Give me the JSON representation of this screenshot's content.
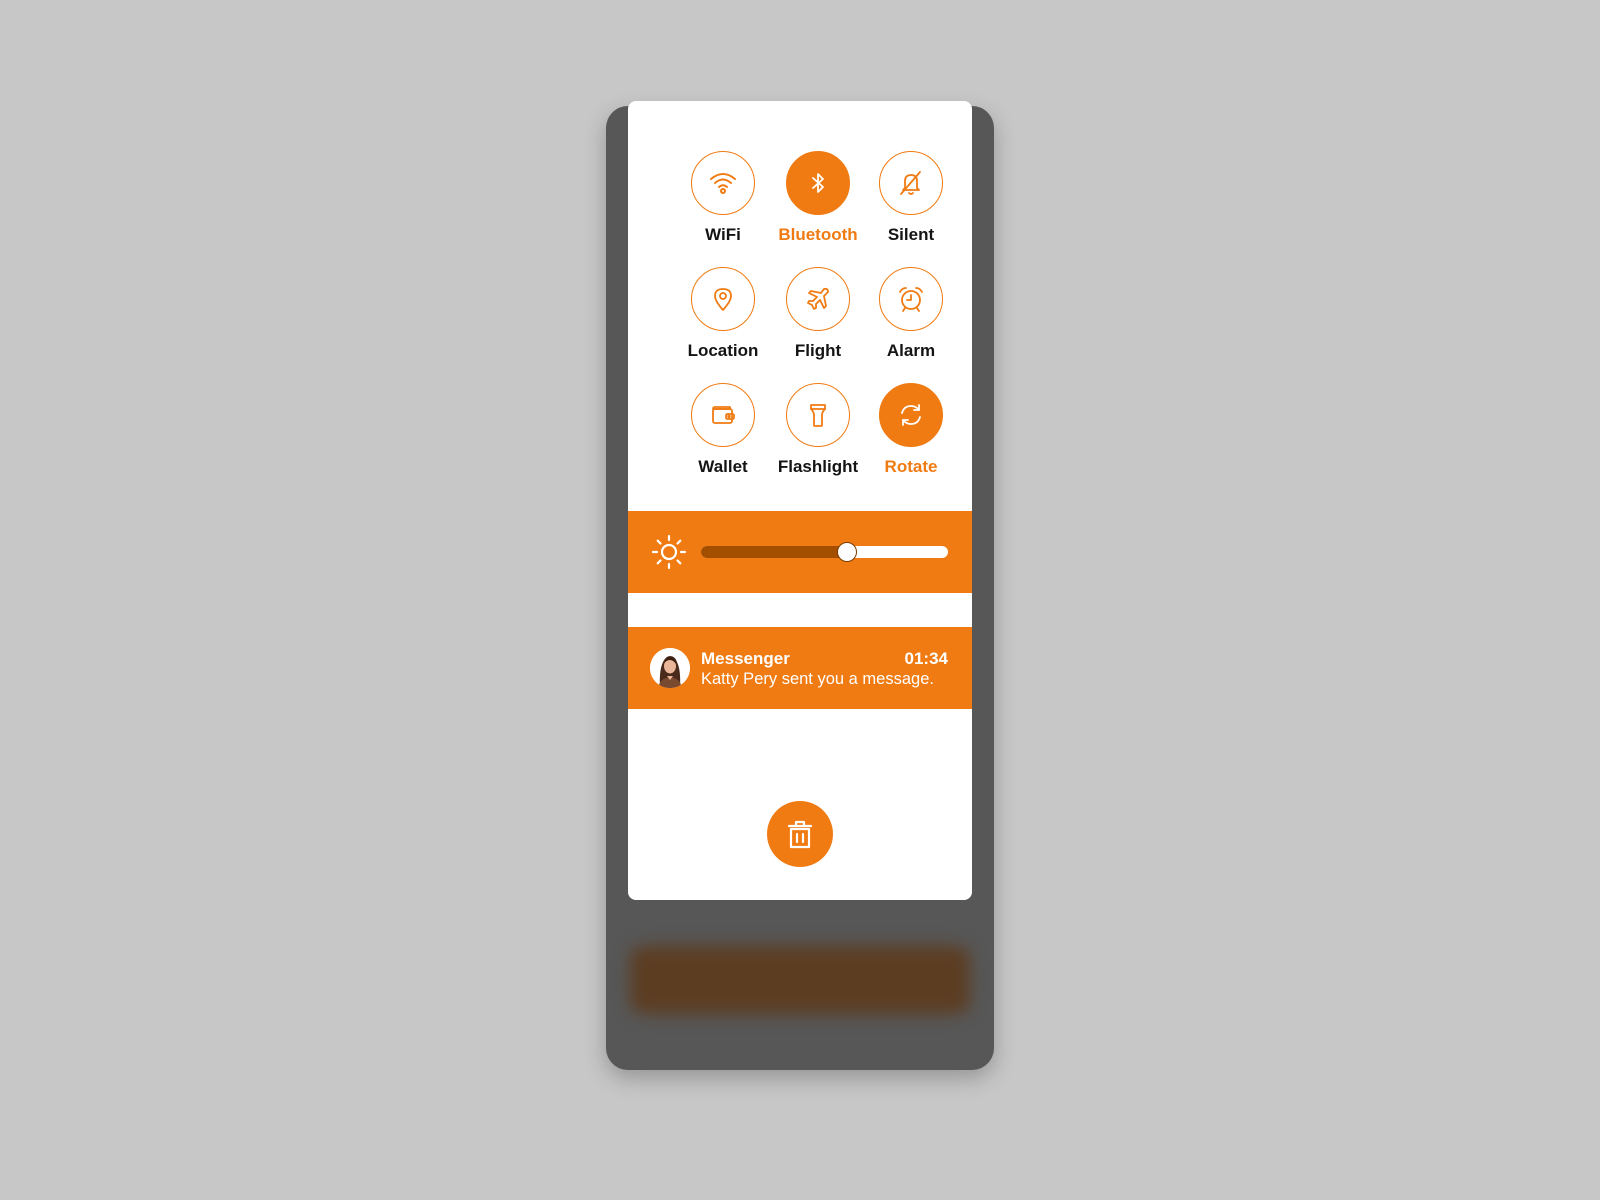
{
  "toggles": [
    {
      "label": "WiFi",
      "icon": "wifi-icon",
      "active": false
    },
    {
      "label": "Bluetooth",
      "icon": "bluetooth-icon",
      "active": true
    },
    {
      "label": "Silent",
      "icon": "bell-off-icon",
      "active": false
    },
    {
      "label": "Location",
      "icon": "location-pin-icon",
      "active": false
    },
    {
      "label": "Flight",
      "icon": "airplane-icon",
      "active": false
    },
    {
      "label": "Alarm",
      "icon": "alarm-clock-icon",
      "active": false
    },
    {
      "label": "Wallet",
      "icon": "wallet-icon",
      "active": false
    },
    {
      "label": "Flashlight",
      "icon": "flashlight-icon",
      "active": false
    },
    {
      "label": "Rotate",
      "icon": "rotate-icon",
      "active": true
    }
  ],
  "brightness": {
    "icon": "sun-icon",
    "level": 0.59
  },
  "notification": {
    "app": "Messenger",
    "time": "01:34",
    "message": "Katty Pery sent you a message.",
    "avatar_icon": "avatar-icon"
  },
  "clear_button": {
    "icon": "trash-icon"
  },
  "colors": {
    "accent": "#f07b12",
    "background": "#c7c7c7",
    "shell": "#575757",
    "panel": "#ffffff"
  }
}
